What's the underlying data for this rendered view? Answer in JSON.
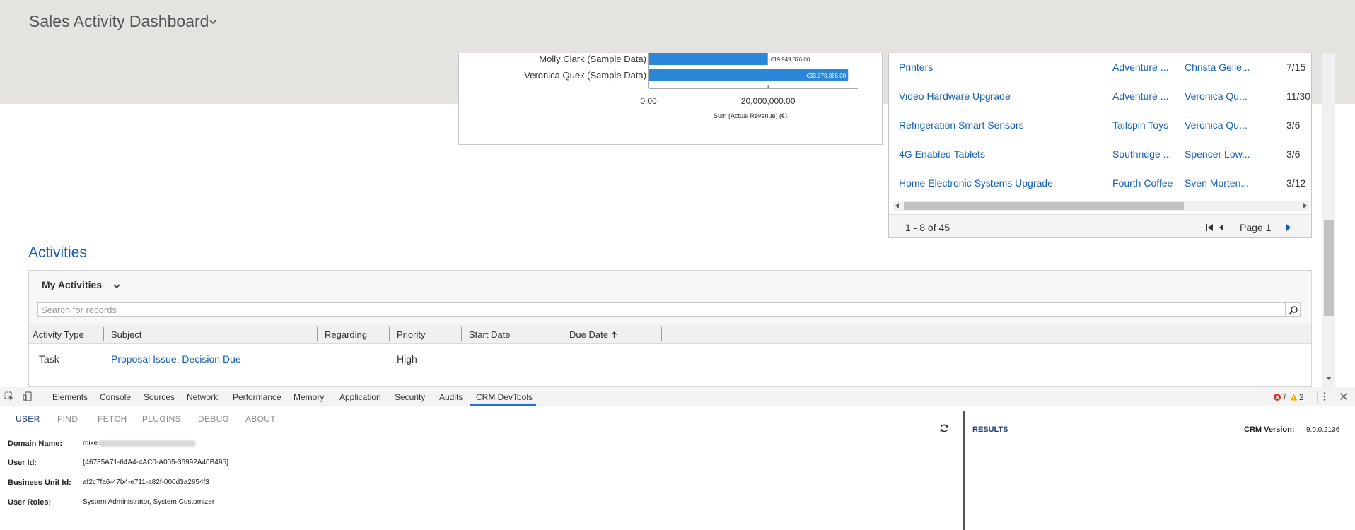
{
  "app": {
    "title": "Sales Activity Dashboard"
  },
  "chart_data": {
    "type": "bar",
    "orientation": "horizontal",
    "categories": [
      "Molly Clark (Sample Data)",
      "Veronica Quek (Sample Data)"
    ],
    "values": [
      19949376.0,
      33370385.0
    ],
    "value_labels": [
      "€19,949,376.00",
      "€33,370,385.00"
    ],
    "xlabel": "Sum (Actual Revenue) (€)",
    "x_ticks": [
      "0.00",
      "20,000,000.00"
    ],
    "x_tick_values": [
      0,
      20000000
    ],
    "xlim": [
      0,
      35000000
    ],
    "bar_color": "#2b88d8"
  },
  "opportunities": {
    "rows": [
      {
        "name": "Printers",
        "account": "Adventure ...",
        "owner": "Christa Gelle...",
        "date": "7/15"
      },
      {
        "name": "Video Hardware Upgrade",
        "account": "Adventure ...",
        "owner": "Veronica Qu...",
        "date": "11/30"
      },
      {
        "name": "Refrigeration Smart Sensors",
        "account": "Tailspin Toys",
        "owner": "Veronica Qu...",
        "date": "3/6"
      },
      {
        "name": "4G Enabled Tablets",
        "account": "Southridge ...",
        "owner": "Spencer Low...",
        "date": "3/6"
      },
      {
        "name": "Home Electronic Systems Upgrade",
        "account": "Fourth Coffee",
        "owner": "Sven Morten...",
        "date": "3/12"
      }
    ],
    "footer": {
      "count": "1 - 8 of 45",
      "page": "Page 1"
    }
  },
  "activities": {
    "heading": "Activities",
    "view_name": "My Activities",
    "search_placeholder": "Search for records",
    "columns": [
      "Activity Type",
      "Subject",
      "Regarding",
      "Priority",
      "Start Date",
      "Due Date"
    ],
    "sort_column": "Due Date",
    "rows": [
      {
        "activity_type": "Task",
        "subject": "Proposal Issue, Decision Due",
        "regarding": "",
        "priority": "High",
        "start_date": "",
        "due_date": ""
      }
    ]
  },
  "devtools": {
    "tabs": [
      "Elements",
      "Console",
      "Sources",
      "Network",
      "Performance",
      "Memory",
      "Application",
      "Security",
      "Audits",
      "CRM DevTools"
    ],
    "active_tab": "CRM DevTools",
    "error_count": "7",
    "warning_count": "2",
    "error_color": "#d93025",
    "warning_color": "#f2a900"
  },
  "crm_devtools": {
    "nav": [
      "USER",
      "FIND",
      "FETCH",
      "PLUGINS",
      "DEBUG",
      "ABOUT"
    ],
    "active_nav": "USER",
    "fields": [
      {
        "label": "Domain Name:",
        "value": "mike"
      },
      {
        "label": "User Id:",
        "value": "{46735A71-64A4-4AC0-A005-36992A40B495}"
      },
      {
        "label": "Business Unit Id:",
        "value": "af2c7fa6-47b4-e711-a82f-000d3a2654f3"
      },
      {
        "label": "User Roles:",
        "value": "System Administrator, System Customizer"
      }
    ],
    "results_label": "RESULTS",
    "version_label": "CRM Version:",
    "version_value": "9.0.0.2136"
  }
}
